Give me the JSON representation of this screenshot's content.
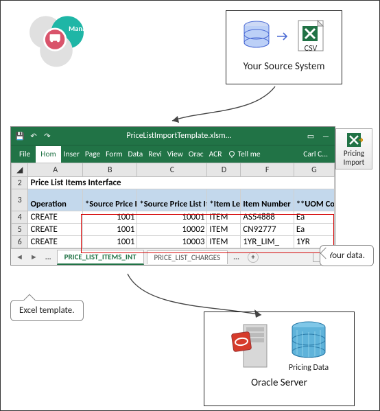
{
  "manage": {
    "label": "Manage"
  },
  "source_system": {
    "label": "Your Source System",
    "csv_label": "CSV"
  },
  "pricing_import": {
    "line1": "Pricing",
    "line2": "Import"
  },
  "excel": {
    "title": "PriceListImportTemplate.xlsm...",
    "ribbon": {
      "file": "File",
      "tabs": [
        "Hom",
        "Inser",
        "Page",
        "Form",
        "Data",
        "Revi",
        "View",
        "Orac",
        "ACR"
      ],
      "tell": "Tell me",
      "user": "Carl C..."
    },
    "columns": [
      "A",
      "B",
      "C",
      "D",
      "F",
      "G"
    ],
    "interface_title": "Price List Items Interface",
    "headers": {
      "operation": "Operation",
      "source_price_list_id": "*Source Price List ID",
      "source_price_list_item_id": "*Source Price List Item ID",
      "item_level": "*Item Level",
      "item_number": "Item Number",
      "uom_code": "**UOM Code"
    },
    "rows": [
      {
        "n": "4",
        "op": "CREATE",
        "spl": "1001",
        "spli": "10001",
        "lvl": "ITEM",
        "item": "AS54888",
        "uom": "Ea"
      },
      {
        "n": "5",
        "op": "CREATE",
        "spl": "1001",
        "spli": "10002",
        "lvl": "ITEM",
        "item": "CN92777",
        "uom": "Ea"
      },
      {
        "n": "6",
        "op": "CREATE",
        "spl": "1001",
        "spli": "10003",
        "lvl": "ITEM",
        "item": "1YR_LIM_",
        "uom": "1YR"
      }
    ],
    "sheet_tabs": {
      "dots": "...",
      "active": "PRICE_LIST_ITEMS_INT",
      "other": "PRICE_LIST_CHARGES",
      "more": "..."
    }
  },
  "oracle": {
    "pricing_data": "Pricing Data",
    "title": "Oracle Server"
  },
  "callouts": {
    "excel_template": "Excel template.",
    "your_data": "Your data."
  }
}
